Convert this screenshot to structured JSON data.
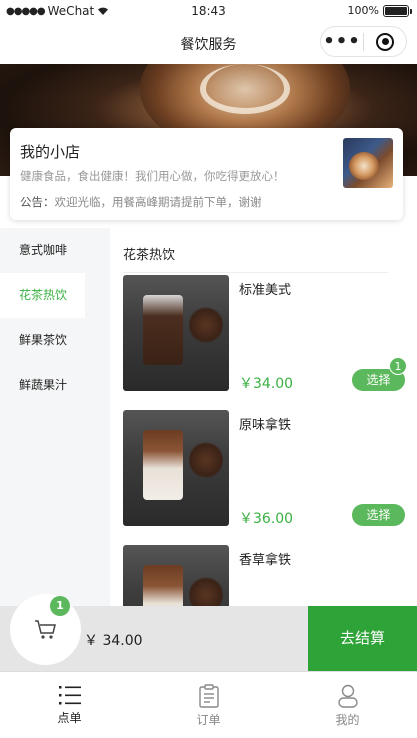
{
  "status_bar": {
    "carrier": "WeChat",
    "time": "18:43",
    "battery": "100%"
  },
  "nav": {
    "title": "餐饮服务"
  },
  "shop": {
    "name": "我的小店",
    "description": "健康食品，食出健康！我们用心做，你吃得更放心！",
    "notice_label": "公告：",
    "notice_text": "欢迎光临，用餐高峰期请提前下单，谢谢"
  },
  "sidebar": {
    "items": [
      {
        "label": "意式咖啡"
      },
      {
        "label": "花茶热饮"
      },
      {
        "label": "鲜果茶饮"
      },
      {
        "label": "鲜蔬果汁"
      }
    ],
    "active_index": 1
  },
  "main": {
    "category_title": "花茶热饮",
    "products": [
      {
        "name": "标准美式",
        "price": "￥34.00",
        "select_label": "选择",
        "count": "1"
      },
      {
        "name": "原味拿铁",
        "price": "￥36.00",
        "select_label": "选择"
      },
      {
        "name": "香草拿铁"
      }
    ]
  },
  "cart": {
    "count": "1",
    "total": "￥ 34.00",
    "checkout_label": "去结算"
  },
  "tab_bar": {
    "tabs": [
      {
        "label": "点单",
        "icon": "list-icon",
        "active": true
      },
      {
        "label": "订单",
        "icon": "clipboard-icon"
      },
      {
        "label": "我的",
        "icon": "user-icon"
      }
    ]
  },
  "colors": {
    "accent": "#3ab042",
    "button": "#5cb85c",
    "checkout": "#2ea338"
  }
}
